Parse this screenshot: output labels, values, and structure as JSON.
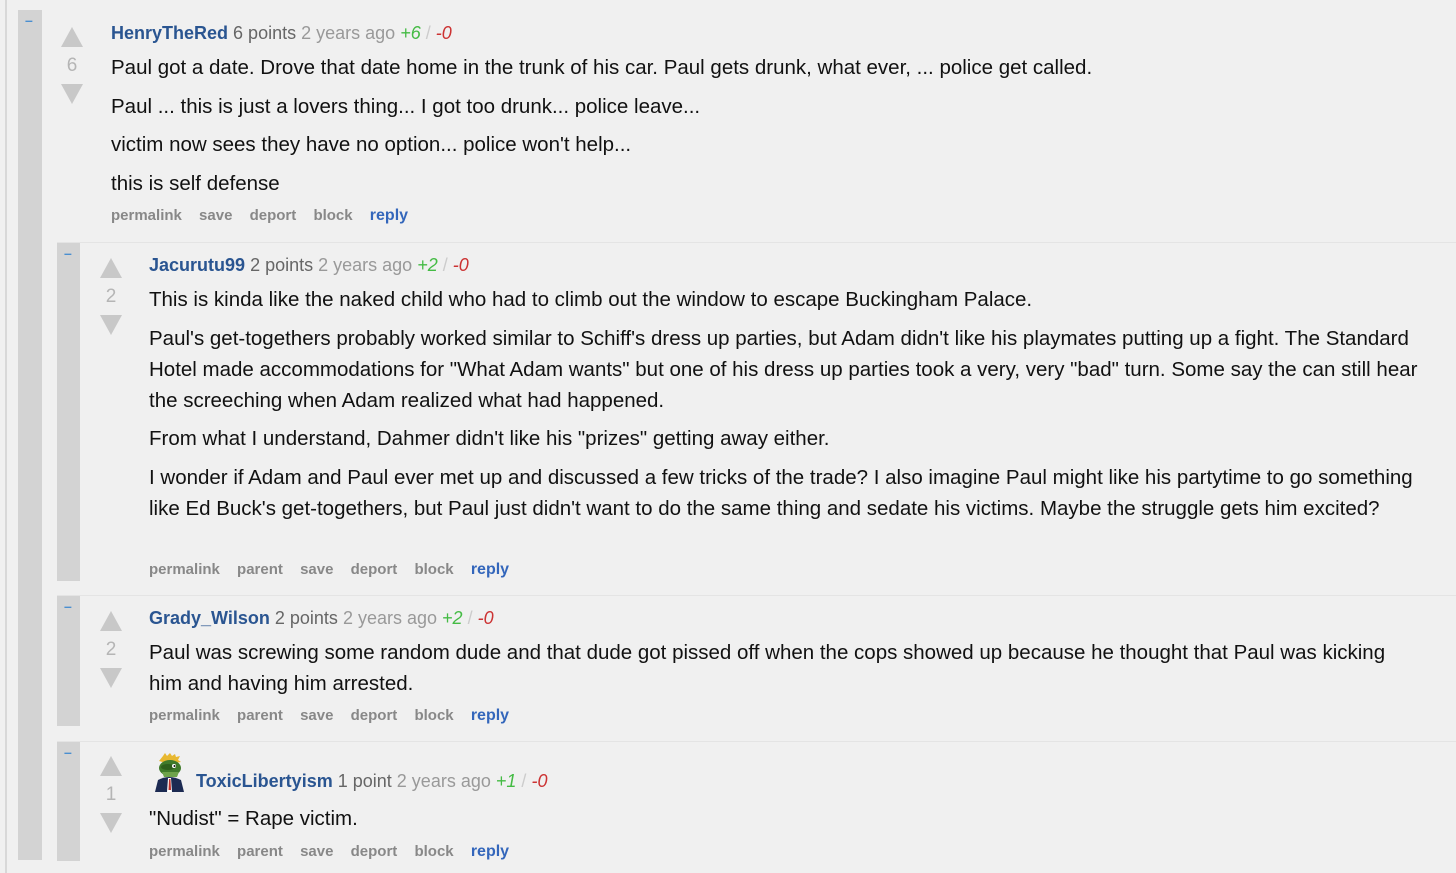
{
  "comments": [
    {
      "collapse": "–",
      "author": "HenryTheRed",
      "points": "6 points",
      "age": "2 years ago",
      "upvotes": "+6",
      "slash": "/",
      "downvotes": "-0",
      "score": "6",
      "paragraphs": [
        "Paul got a date. Drove that date home in the trunk of his car. Paul gets drunk, what ever, ... police get called.",
        "Paul ... this is just a lovers thing... I got too drunk... police leave...",
        "victim now sees they have no option... police won't help...",
        "this is self defense"
      ],
      "buttons": [
        "permalink",
        "save",
        "deport",
        "block",
        "reply"
      ]
    },
    {
      "collapse": "–",
      "author": "Jacurutu99",
      "points": "2 points",
      "age": "2 years ago",
      "upvotes": "+2",
      "slash": "/",
      "downvotes": "-0",
      "score": "2",
      "paragraphs": [
        "This is kinda like the naked child who had to climb out the window to escape Buckingham Palace.",
        "Paul's get-togethers probably worked similar to Schiff's dress up parties, but Adam didn't like his playmates putting up a fight. The Standard Hotel made accommodations for \"What Adam wants\" but one of his dress up parties took a very, very \"bad\" turn. Some say the can still hear the screeching when Adam realized what had happened.",
        "From what I understand, Dahmer didn't like his \"prizes\" getting away either.",
        "I wonder if Adam and Paul ever met up and discussed a few tricks of the trade? I also imagine Paul might like his partytime to go something like Ed Buck's get-togethers, but Paul just didn't want to do the same thing and sedate his victims. Maybe the struggle gets him excited?"
      ],
      "buttons": [
        "permalink",
        "parent",
        "save",
        "deport",
        "block",
        "reply"
      ]
    },
    {
      "collapse": "–",
      "author": "Grady_Wilson",
      "points": "2 points",
      "age": "2 years ago",
      "upvotes": "+2",
      "slash": "/",
      "downvotes": "-0",
      "score": "2",
      "paragraphs": [
        "Paul was screwing some random dude and that dude got pissed off when the cops showed up because he thought that Paul was kicking him and having him arrested."
      ],
      "buttons": [
        "permalink",
        "parent",
        "save",
        "deport",
        "block",
        "reply"
      ]
    },
    {
      "collapse": "–",
      "author": "ToxicLibertyism",
      "points": "1 point",
      "age": "2 years ago",
      "upvotes": "+1",
      "slash": "/",
      "downvotes": "-0",
      "score": "1",
      "paragraphs": [
        "\"Nudist\" = Rape victim."
      ],
      "buttons": [
        "permalink",
        "parent",
        "save",
        "deport",
        "block",
        "reply"
      ]
    }
  ]
}
